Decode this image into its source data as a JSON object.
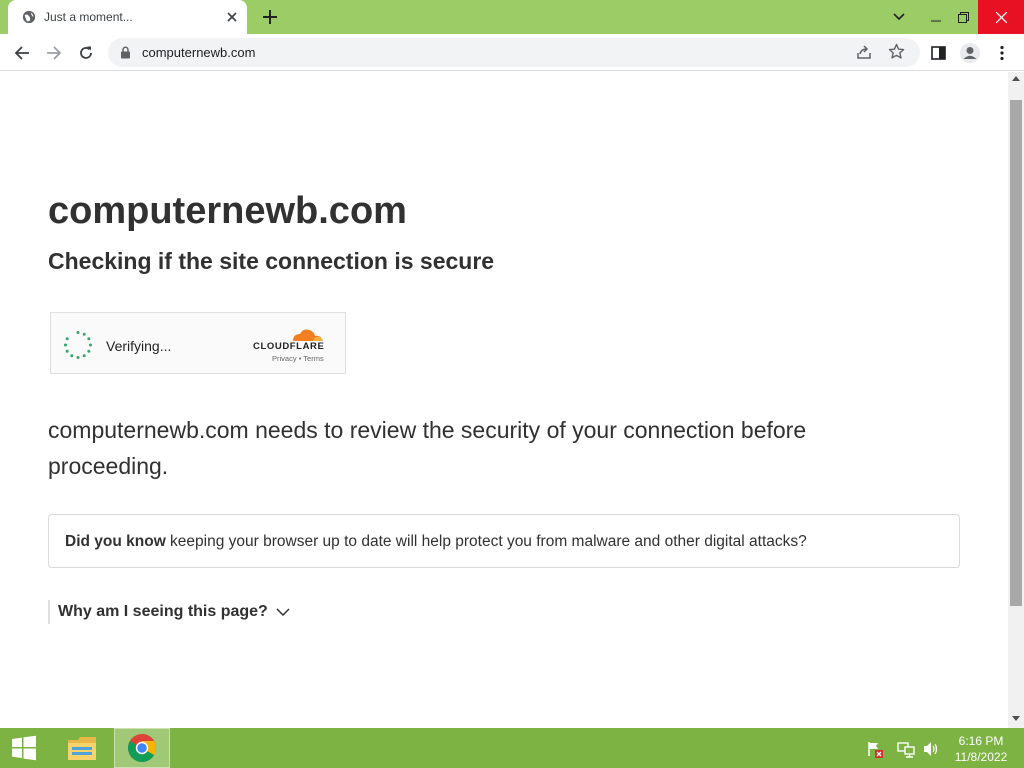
{
  "browser": {
    "tab_title": "Just a moment...",
    "url": "computernewb.com"
  },
  "page": {
    "site_title": "computernewb.com",
    "subtitle": "Checking if the site connection is secure",
    "widget": {
      "status": "Verifying...",
      "brand": "CLOUDFLARE",
      "privacy_link": "Privacy",
      "separator": "•",
      "terms_link": "Terms"
    },
    "description": "computernewb.com needs to review the security of your connection before proceeding.",
    "tip": {
      "lead": "Did you know",
      "text": " keeping your browser up to date will help protect you from malware and other digital attacks?"
    },
    "why_label": "Why am I seeing this page?"
  },
  "taskbar": {
    "time": "6:16 PM",
    "date": "11/8/2022"
  },
  "colors": {
    "chrome_frame": "#9ccc65",
    "taskbar": "#7cb342",
    "text": "#313131",
    "cloudflare_orange": "#f38020",
    "spinner": "#35a56b"
  }
}
